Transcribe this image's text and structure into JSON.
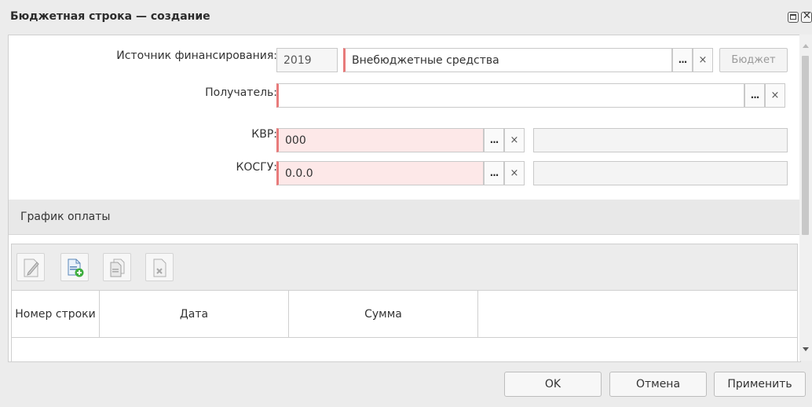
{
  "window": {
    "title": "Бюджетная строка — создание"
  },
  "form": {
    "source_label": "Источник финансирования:",
    "source_year": "2019",
    "source_value": "Внебюджетные средства",
    "budget_button": "Бюджет",
    "recipient_label": "Получатель:",
    "recipient_value": "",
    "kvr_label": "КВР:",
    "kvr_value": "000",
    "kvr_desc": "",
    "kosgu_label": "КОСГУ:",
    "kosgu_value": "0.0.0",
    "kosgu_desc": "",
    "dots": "...",
    "clear": "×"
  },
  "schedule": {
    "title": "График оплаты",
    "columns": [
      "Номер строки",
      "Дата",
      "Сумма",
      ""
    ]
  },
  "toolbar": {
    "icons": [
      "edit-icon",
      "add-document-icon",
      "copy-document-icon",
      "delete-document-icon"
    ]
  },
  "footer": {
    "ok": "OK",
    "cancel": "Отмена",
    "apply": "Применить"
  }
}
